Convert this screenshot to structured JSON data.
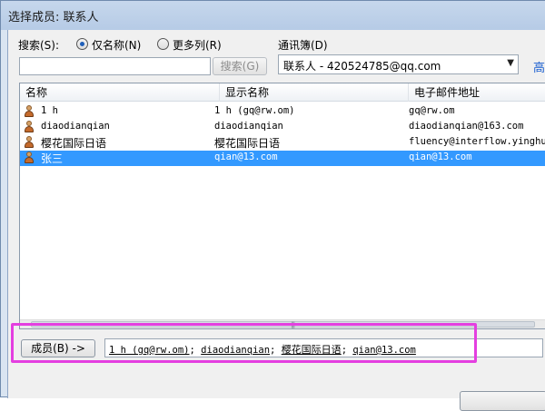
{
  "window": {
    "title": "选择成员: 联系人"
  },
  "search": {
    "label": "搜索(S):",
    "mode_name_only": "仅名称(N)",
    "mode_more_columns": "更多列(R)",
    "input_value": "",
    "button_label": "搜索(G)"
  },
  "addressbook": {
    "label": "通讯簿(D)",
    "selected": "联系人 - 420524785@qq.com",
    "advanced_link": "高"
  },
  "list": {
    "columns": [
      "名称",
      "显示名称",
      "电子邮件地址"
    ],
    "rows": [
      {
        "name": "1 h",
        "display": "1 h (gq@rw.om)",
        "email": "gq@rw.om",
        "selected": false
      },
      {
        "name": "diaodianqian",
        "display": "diaodianqian",
        "email": "diaodianqian@163.com",
        "selected": false
      },
      {
        "name": "樱花国际日语",
        "display": "樱花国际日语",
        "email": "fluency@interflow.yinghu",
        "selected": false
      },
      {
        "name": "张三",
        "display": "qian@13.com",
        "email": "qian@13.com",
        "selected": true
      }
    ],
    "scrollbar_grip": "|||"
  },
  "members": {
    "button_label": "成员(B) ->",
    "items": [
      "1 h (gq@rw.om)",
      "diaodianqian",
      "樱花国际日语",
      "qian@13.com"
    ],
    "separator": "; "
  },
  "colors": {
    "selection": "#3399ff",
    "highlight_border": "#e43fe0",
    "link": "#1a5fd0"
  },
  "icons": {
    "contact": "person-icon"
  }
}
